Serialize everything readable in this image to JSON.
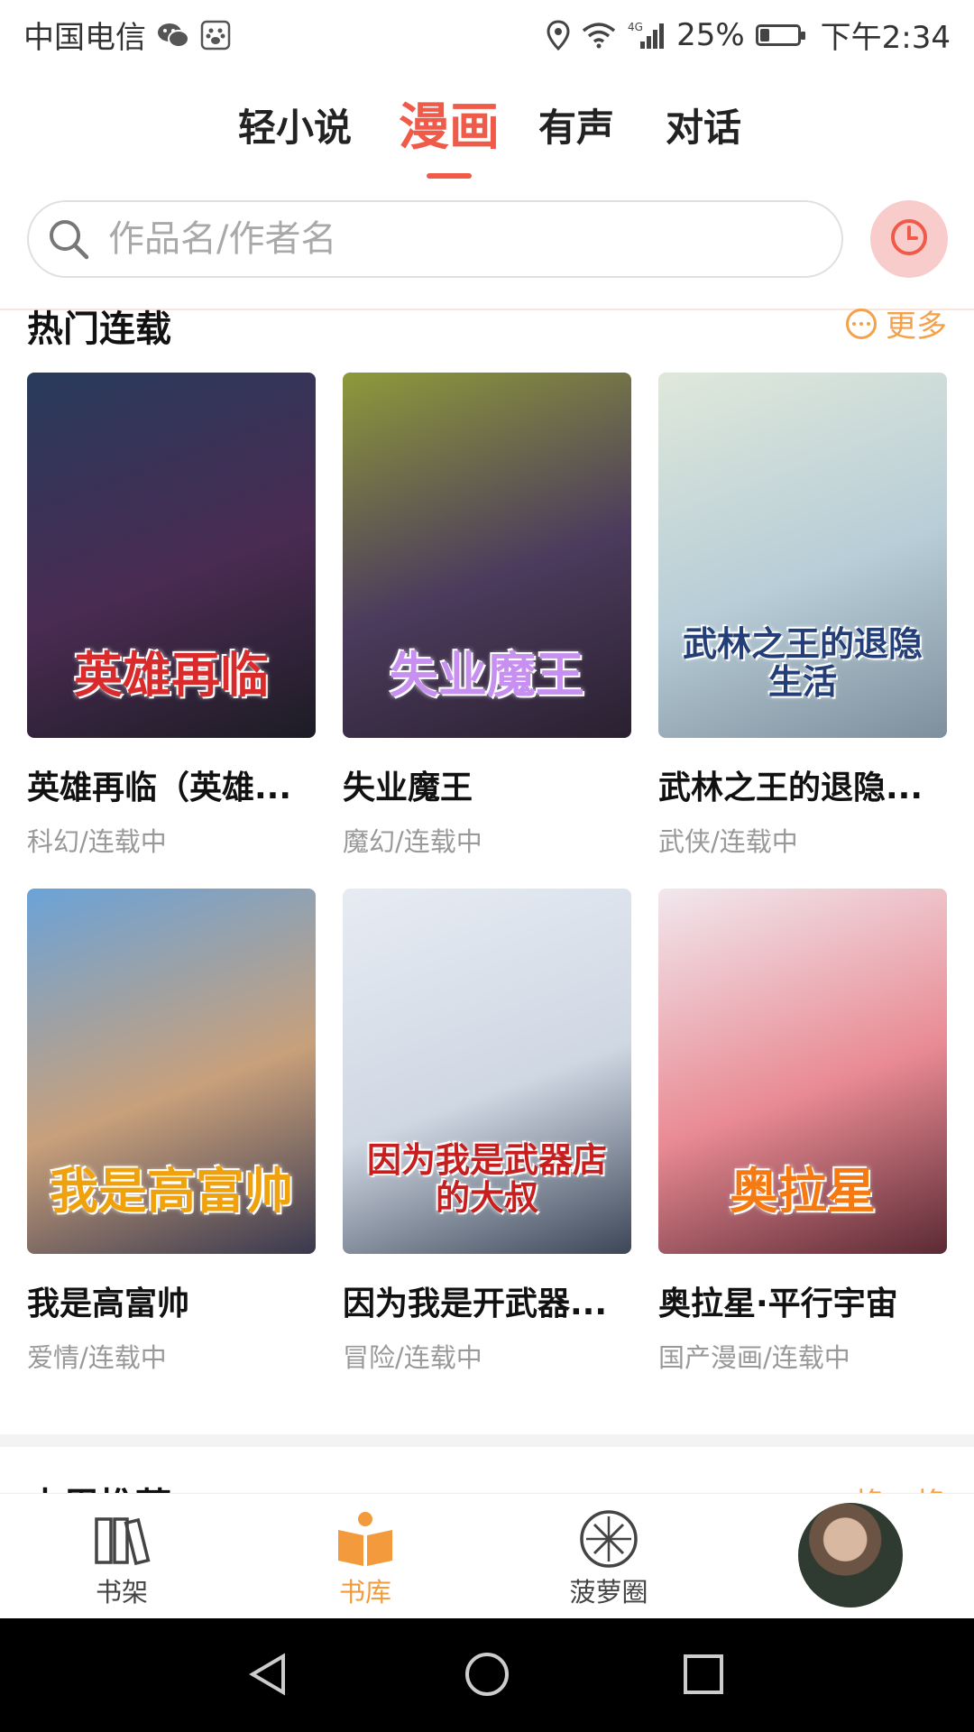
{
  "status_bar": {
    "carrier": "中国电信",
    "network": "4G",
    "battery": "25%",
    "battery_level": 0.25,
    "time": "下午2:34"
  },
  "tabs": [
    {
      "label": "轻小说",
      "active": false
    },
    {
      "label": "漫画",
      "active": true
    },
    {
      "label": "有声",
      "active": false
    },
    {
      "label": "对话",
      "active": false
    }
  ],
  "search": {
    "placeholder": "作品名/作者名"
  },
  "section": {
    "title": "热门连载",
    "more_label": "更多"
  },
  "comics": [
    {
      "title": "英雄再临（英雄...",
      "meta": "科幻/连载中",
      "cover_text": "英雄再临",
      "cover_colors": [
        "#283b5c",
        "#4a2b52",
        "#1c1c24"
      ],
      "text_color": "#d92b2b"
    },
    {
      "title": "失业魔王",
      "meta": "魔幻/连载中",
      "cover_text": "失业魔王",
      "cover_colors": [
        "#8e9a3a",
        "#4c3b5d",
        "#2a2030"
      ],
      "text_color": "#c78ff0"
    },
    {
      "title": "武林之王的退隐...",
      "meta": "武侠/连载中",
      "cover_text": "武林之王的退隐生活",
      "cover_colors": [
        "#dfe8da",
        "#b8cdd8",
        "#7d8f9c"
      ],
      "text_color": "#243e77"
    },
    {
      "title": "我是高富帅",
      "meta": "爱情/连载中",
      "cover_text": "我是高富帅",
      "cover_colors": [
        "#6ba3d8",
        "#c8a07b",
        "#39384e"
      ],
      "text_color": "#f0a20d"
    },
    {
      "title": "因为我是开武器...",
      "meta": "冒险/连载中",
      "cover_text": "因为我是武器店的大叔",
      "cover_colors": [
        "#e7ecf3",
        "#cfd7e3",
        "#3c4657"
      ],
      "text_color": "#c51f1f"
    },
    {
      "title": "奥拉星·平行宇宙",
      "meta": "国产漫画/连载中",
      "cover_text": "奥拉星",
      "cover_colors": [
        "#f1e8ee",
        "#e98a93",
        "#5b2a34"
      ],
      "text_color": "#f57a12"
    }
  ],
  "next_section": {
    "title": "本周推荐",
    "more_label": "换一换"
  },
  "bottom_nav": [
    {
      "label": "书架",
      "icon": "bookshelf-icon",
      "active": false
    },
    {
      "label": "书库",
      "icon": "library-icon",
      "active": true
    },
    {
      "label": "菠萝圈",
      "icon": "pineapple-circle-icon",
      "active": false
    }
  ],
  "colors": {
    "accent_red": "#ef5b48",
    "accent_orange": "#f39a3c",
    "more_orange": "#f4a14a"
  }
}
